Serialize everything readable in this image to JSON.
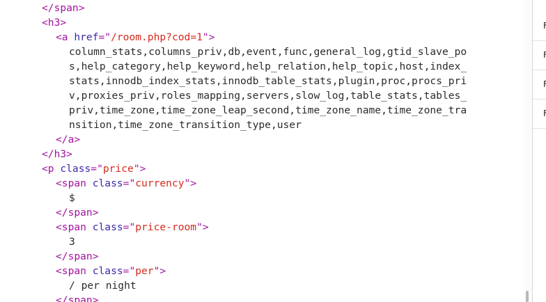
{
  "source": {
    "lines": [
      {
        "indent": 60,
        "parts": [
          [
            "tag",
            "</span>"
          ]
        ]
      },
      {
        "indent": 60,
        "parts": [
          [
            "tag",
            "<h3>"
          ]
        ]
      },
      {
        "indent": 80,
        "parts": [
          [
            "tag",
            "<a "
          ],
          [
            "attr",
            "href"
          ],
          [
            "tag",
            "=\""
          ],
          [
            "val",
            "/room.php?cod=1"
          ],
          [
            "tag",
            "\">"
          ]
        ]
      },
      {
        "indent": 99,
        "parts": [
          [
            "txt",
            "column_stats,columns_priv,db,event,func,general_log,gtid_slave_po"
          ]
        ]
      },
      {
        "indent": 99,
        "parts": [
          [
            "txt",
            "s,help_category,help_keyword,help_relation,help_topic,host,index_"
          ]
        ]
      },
      {
        "indent": 99,
        "parts": [
          [
            "txt",
            "stats,innodb_index_stats,innodb_table_stats,plugin,proc,procs_pri"
          ]
        ]
      },
      {
        "indent": 99,
        "parts": [
          [
            "txt",
            "v,proxies_priv,roles_mapping,servers,slow_log,table_stats,tables_"
          ]
        ]
      },
      {
        "indent": 99,
        "parts": [
          [
            "txt",
            "priv,time_zone,time_zone_leap_second,time_zone_name,time_zone_tra"
          ]
        ]
      },
      {
        "indent": 99,
        "parts": [
          [
            "txt",
            "nsition,time_zone_transition_type,user"
          ]
        ]
      },
      {
        "indent": 80,
        "parts": [
          [
            "tag",
            "</a>"
          ]
        ]
      },
      {
        "indent": 60,
        "parts": [
          [
            "tag",
            "</h3>"
          ]
        ]
      },
      {
        "indent": 60,
        "parts": [
          [
            "tag",
            "<p "
          ],
          [
            "attr",
            "class"
          ],
          [
            "tag",
            "=\""
          ],
          [
            "val",
            "price"
          ],
          [
            "tag",
            "\">"
          ]
        ]
      },
      {
        "indent": 80,
        "parts": [
          [
            "tag",
            "<span "
          ],
          [
            "attr",
            "class"
          ],
          [
            "tag",
            "=\""
          ],
          [
            "val",
            "currency"
          ],
          [
            "tag",
            "\">"
          ]
        ]
      },
      {
        "indent": 99,
        "parts": [
          [
            "txt",
            "$"
          ]
        ]
      },
      {
        "indent": 80,
        "parts": [
          [
            "tag",
            "</span>"
          ]
        ]
      },
      {
        "indent": 80,
        "parts": [
          [
            "tag",
            "<span "
          ],
          [
            "attr",
            "class"
          ],
          [
            "tag",
            "=\""
          ],
          [
            "val",
            "price-room"
          ],
          [
            "tag",
            "\">"
          ]
        ]
      },
      {
        "indent": 99,
        "parts": [
          [
            "txt",
            "3"
          ]
        ]
      },
      {
        "indent": 80,
        "parts": [
          [
            "tag",
            "</span>"
          ]
        ]
      },
      {
        "indent": 80,
        "parts": [
          [
            "tag",
            "<span "
          ],
          [
            "attr",
            "class"
          ],
          [
            "tag",
            "=\""
          ],
          [
            "val",
            "per"
          ],
          [
            "tag",
            "\">"
          ]
        ]
      },
      {
        "indent": 99,
        "parts": [
          [
            "txt",
            "/ per night"
          ]
        ]
      },
      {
        "indent": 80,
        "parts": [
          [
            "tag",
            "</span>"
          ]
        ]
      }
    ]
  },
  "side_panel": {
    "rows": [
      "F",
      "F",
      "F",
      "F"
    ]
  },
  "colors": {
    "tag": "#a1139e",
    "attribute": "#3a2aa6",
    "value": "#d42a1d",
    "text": "#2b2b2b"
  }
}
